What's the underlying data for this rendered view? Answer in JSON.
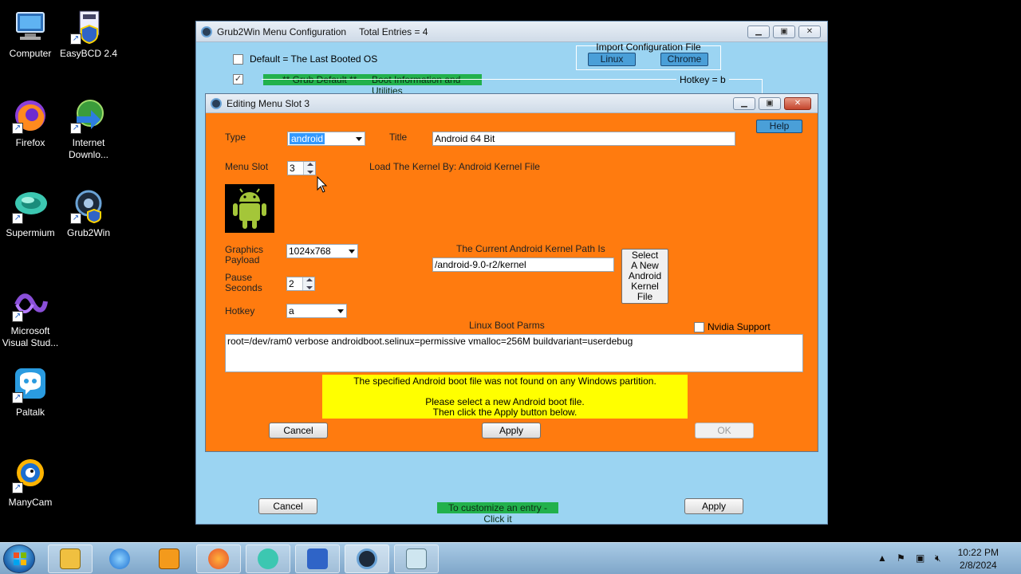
{
  "desktop": {
    "icons": [
      {
        "label": "Computer"
      },
      {
        "label": "EasyBCD 2.4"
      },
      {
        "label": "Firefox"
      },
      {
        "label": "Internet Downlo..."
      },
      {
        "label": "Supermium"
      },
      {
        "label": "Grub2Win"
      },
      {
        "label": "Microsoft Visual Stud..."
      },
      {
        "label": "Paltalk"
      },
      {
        "label": "ManyCam"
      }
    ]
  },
  "main_window": {
    "title": "Grub2Win Menu Configuration",
    "total_entries": "Total Entries = 4",
    "default_last_booted": "Default = The Last Booted OS",
    "import_label": "Import Configuration File",
    "linux_button": "Linux",
    "chrome_button": "Chrome",
    "grub_default": "** Grub Default **",
    "boot_info": "Boot Information and Utilities",
    "hotkey": "Hotkey = b",
    "cancel_button": "Cancel",
    "customize_hint": "To customize an entry - Click it",
    "apply_button": "Apply",
    "check_mark": "✓"
  },
  "edit_window": {
    "title": "Editing Menu Slot 3",
    "help_button": "Help",
    "type_label": "Type",
    "type_value": "android",
    "title_label": "Title",
    "title_value": "Android 64 Bit",
    "menu_slot_label": "Menu Slot",
    "menu_slot_value": "3",
    "load_kernel": "Load The Kernel By:  Android Kernel File",
    "graphics_label_1": "Graphics",
    "graphics_label_2": "Payload",
    "graphics_value": "1024x768",
    "kernel_path_label": "The Current Android Kernel Path Is",
    "kernel_path_value": "/android-9.0-r2/kernel",
    "select_kernel_button": [
      "Select",
      "A New",
      "Android",
      "Kernel",
      "File"
    ],
    "pause_label_1": "Pause",
    "pause_label_2": "Seconds",
    "pause_value": "2",
    "hotkey_label": "Hotkey",
    "hotkey_value": "a",
    "boot_parms_label": "Linux Boot Parms",
    "nvidia_label": "Nvidia Support",
    "boot_parms_value": "root=/dev/ram0 verbose androidboot.selinux=permissive vmalloc=256M buildvariant=userdebug",
    "warning_line1": "The specified Android boot file was not found on any Windows partition.",
    "warning_line2": "Please select a new Android boot file.",
    "warning_line3": "Then click the Apply button below.",
    "cancel_button": "Cancel",
    "apply_button": "Apply",
    "ok_button": "OK"
  },
  "taskbar": {
    "time": "10:22 PM",
    "date": "2/8/2024"
  },
  "colors": {
    "main_bg": "#9bd4f2",
    "edit_bg": "#ff7b0f",
    "warning_bg": "#ffff00",
    "green_bar": "#22b14c",
    "blue_button": "#4a9fd8"
  }
}
